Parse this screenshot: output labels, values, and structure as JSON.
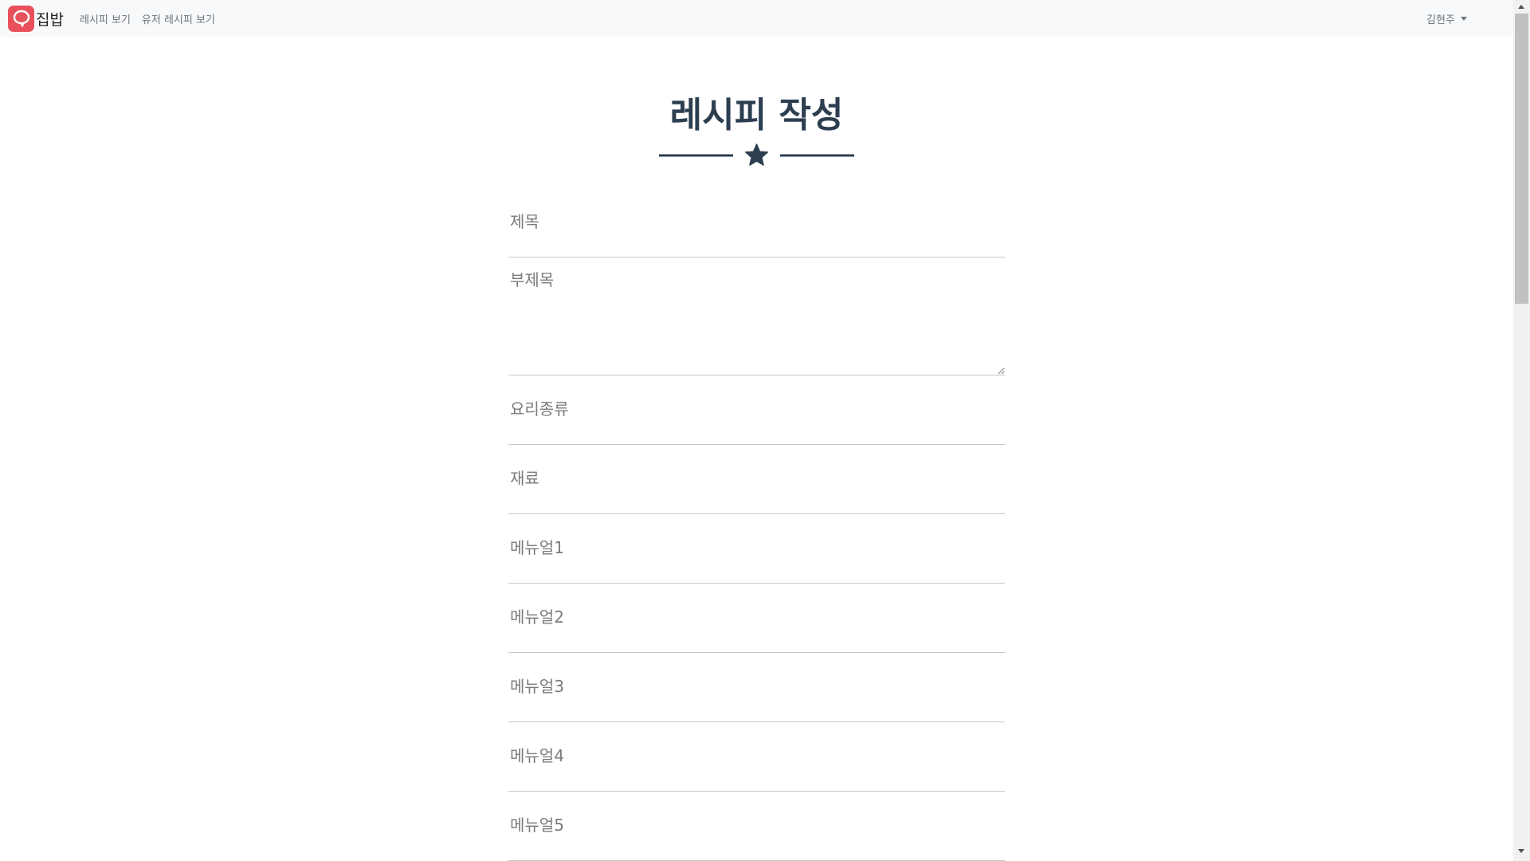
{
  "navbar": {
    "brand": "집밥",
    "links": [
      "레시피 보기",
      "유저 레시피 보기"
    ],
    "user": "김현주"
  },
  "page": {
    "title": "레시피 작성"
  },
  "form": {
    "title_placeholder": "제목",
    "subtitle_placeholder": "부제목",
    "category_placeholder": "요리종류",
    "ingredients_placeholder": "재료",
    "manual1_placeholder": "메뉴얼1",
    "manual2_placeholder": "메뉴얼2",
    "manual3_placeholder": "메뉴얼3",
    "manual4_placeholder": "메뉴얼4",
    "manual5_placeholder": "메뉴얼5"
  },
  "colors": {
    "brand": "#e8505b",
    "heading": "#2c3e50",
    "navbar_bg": "#f8f9fa"
  }
}
